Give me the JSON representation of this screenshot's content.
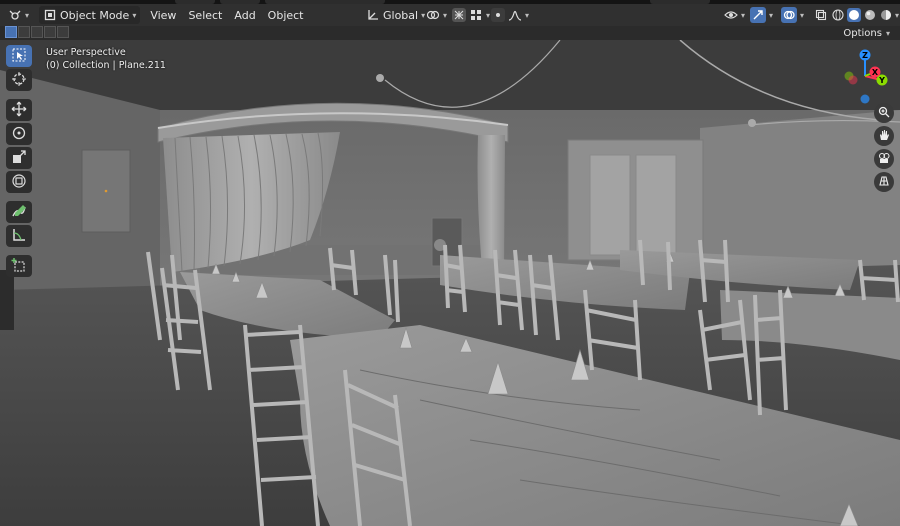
{
  "header": {
    "mode_label": "Object Mode",
    "menu": [
      "View",
      "Select",
      "Add",
      "Object"
    ],
    "transform_orientation": "Global",
    "options_label": "Options"
  },
  "viewport": {
    "perspective_label": "User Perspective",
    "collection_label": "(0) Collection | Plane.211",
    "gizmo_axes": [
      "Z",
      "X",
      "Y"
    ]
  },
  "colors": {
    "accent": "#4772b3",
    "x_axis": "#ff3352",
    "y_axis": "#8bdc00",
    "z_axis": "#2890ff"
  },
  "icons": {
    "editor": "editor-type-icon",
    "mode": "object-mode-icon",
    "orientation": "transform-orientation-icon",
    "pivot": "pivot-point-icon",
    "snap": "snap-icon",
    "proportional": "proportional-edit-icon",
    "visibility": "visibility-icon",
    "gizmo": "gizmo-icon",
    "overlay": "overlay-icon",
    "xray": "xray-icon",
    "shading": [
      "wireframe-shading-icon",
      "solid-shading-icon",
      "material-shading-icon",
      "rendered-shading-icon"
    ],
    "tools": [
      "select-box-icon",
      "cursor-icon",
      "move-icon",
      "rotate-icon",
      "scale-icon",
      "transform-icon",
      "annotate-icon",
      "measure-icon",
      "add-cube-icon"
    ],
    "nav": [
      "zoom-icon",
      "pan-hand-icon",
      "camera-icon",
      "grid-view-icon"
    ]
  }
}
